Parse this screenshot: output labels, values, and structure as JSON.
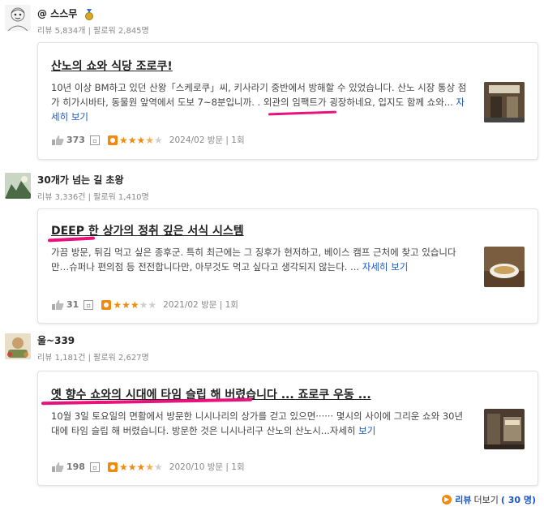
{
  "reviews": [
    {
      "username": "@ 스스무",
      "stats": "리뷰 5,834개 | 팔로워 2,845명",
      "title": "산노의 쇼와 식당 조로쿠!",
      "body": "10년 이상 BM하고 있던 산왕「스케로쿠」씨, 키사라기 중반에서 방해할 수 있었습니다. 산노 시장 통상 점가 히가시바타, 동물원 앞역에서 도보 7~8분입니까. . 외관의 임팩트가 굉장하네요, 입지도 함께 쇼와...",
      "more": "자세히 보기",
      "likes": "373",
      "rating": 3.5,
      "visit": "2024/02 방문 | 1회"
    },
    {
      "username": "30개가 넘는 길 초왕",
      "stats": "리뷰 3,336건 | 팔로워 1,410명",
      "title": "DEEP 한 상가의 정취 깊은 서식 시스템",
      "body": "가끔 방문, 튀김 먹고 싶은 종후군. 특히 최근에는 그 징후가 현저하고, 베이스 캠프 근처에 찾고 있습니다만…슈퍼나 편의점 등 전전합니다만, 아무것도 먹고 싶다고 생각되지 않는다. ...",
      "more": "자세히 보기",
      "likes": "31",
      "rating": 3.0,
      "visit": "2021/02 방문 | 1회"
    },
    {
      "username": "울~339",
      "stats": "리뷰 1,181건 | 팔로워 2,627명",
      "title": "옛 향수 쇼와의 시대에 타임 슬립 해 버렸습니다 ... 죠로쿠 우동 ...",
      "body": "10월 3일 토요일의 면활에서 방문한 니시나리의 상가를 걷고 있으면······ 몇시의 사이에 그리운 쇼와 30년대에 타임 슬립 해 버렸습니다. 방문한 것은 니시나리구 산노의 산노시...자세히",
      "more": "보기",
      "likes": "198",
      "rating": 3.5,
      "visit": "2020/10 방문 | 1회"
    }
  ],
  "footer": {
    "label_review": "리뷰",
    "label_more": "더보기",
    "count": "( 30 명)"
  },
  "colors": {
    "accent": "#f08a10",
    "link": "#1a56c8",
    "marker": "#e8127c"
  }
}
